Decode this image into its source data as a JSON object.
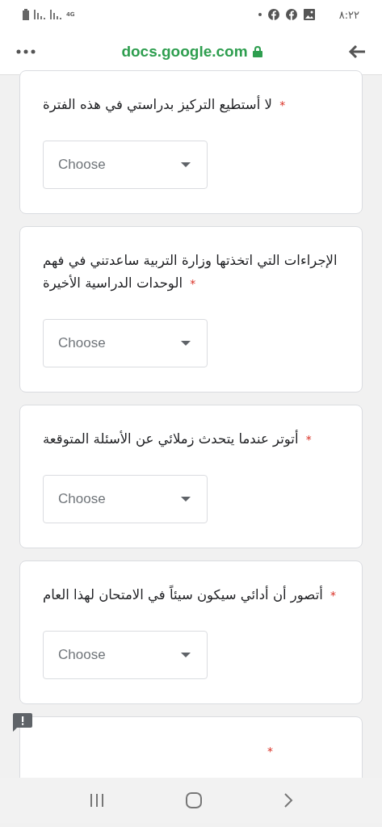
{
  "status_bar": {
    "network": "4G",
    "time": "٨:٢٢"
  },
  "browser": {
    "url": "docs.google.com",
    "secure": true
  },
  "questions": [
    {
      "text": "لا أستطيع التركيز بدراستي في هذه الفترة",
      "required_mark": "*",
      "answer": {
        "placeholder": "Choose"
      }
    },
    {
      "text": "الإجراءات التي اتخذتها وزارة التربية ساعدتني في فهم الوحدات الدراسية الأخيرة",
      "required_mark": "*",
      "answer": {
        "placeholder": "Choose"
      }
    },
    {
      "text": "أتوتر عندما يتحدث زملائي عن الأسئلة المتوقعة",
      "required_mark": "*",
      "answer": {
        "placeholder": "Choose"
      }
    },
    {
      "text": "أتصور أن أدائي سيكون سيئاً في الامتحان لهذا العام",
      "required_mark": "*",
      "answer": {
        "placeholder": "Choose"
      }
    },
    {
      "required_mark": "*",
      "flagged": true
    }
  ]
}
